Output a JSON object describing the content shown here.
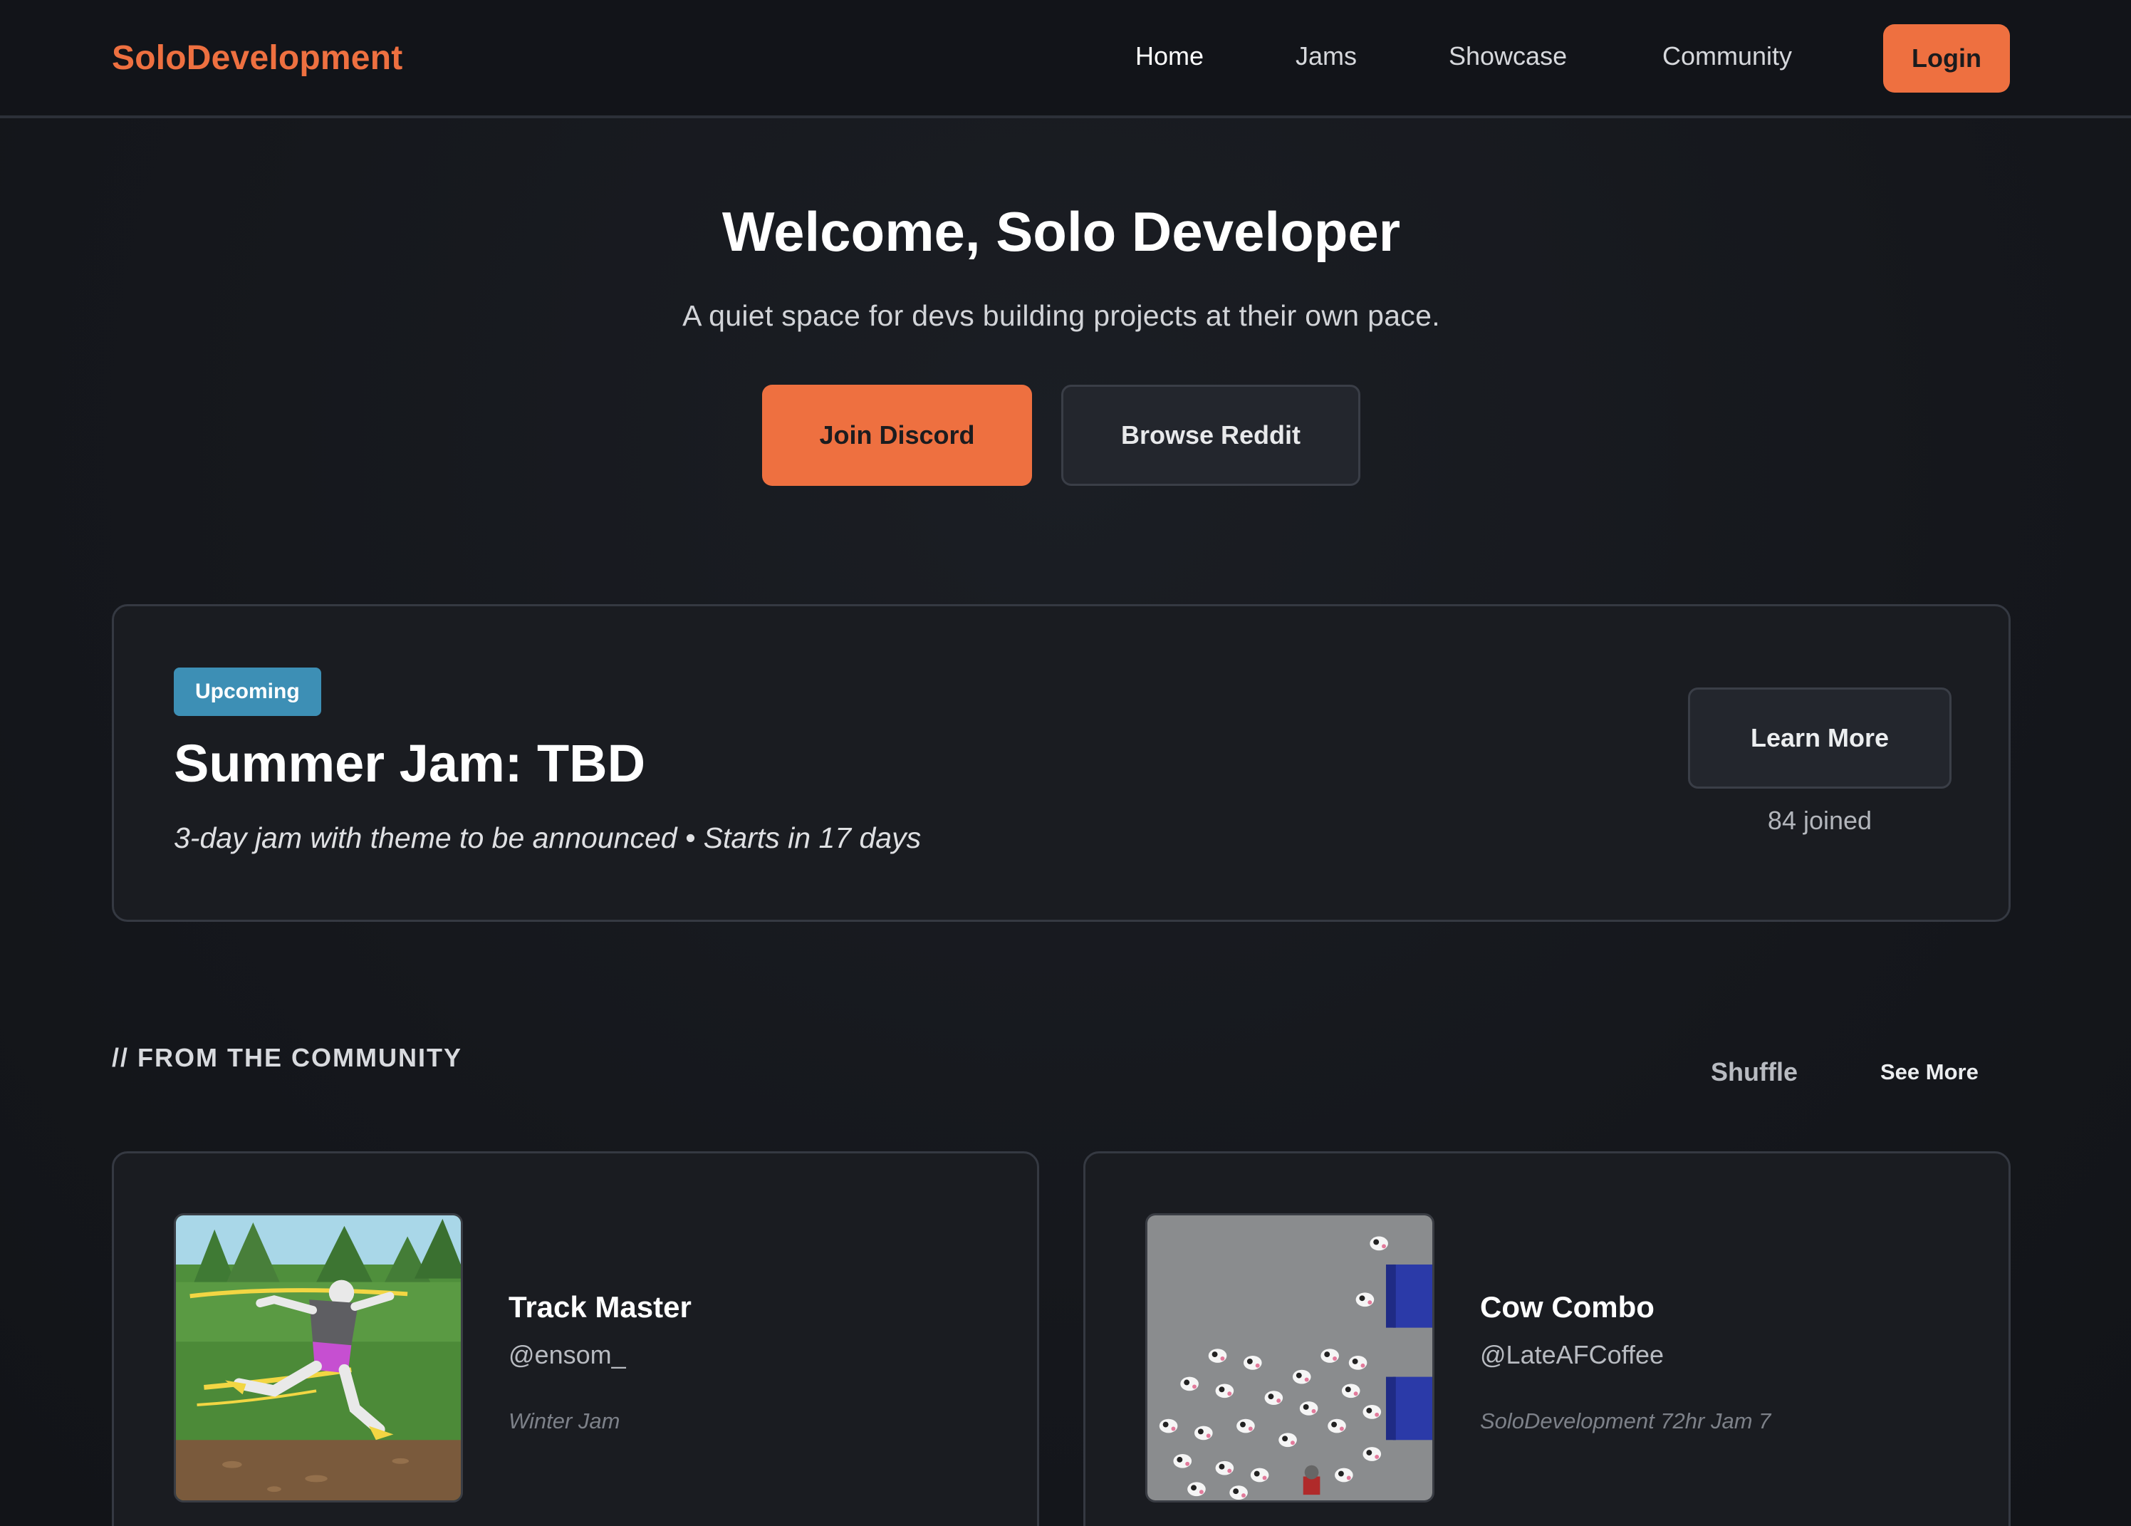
{
  "nav": {
    "brand": "SoloDevelopment",
    "links": [
      "Home",
      "Jams",
      "Showcase",
      "Community"
    ],
    "active": "Home",
    "login_label": "Login"
  },
  "hero": {
    "title": "Welcome, Solo Developer",
    "subtitle": "A quiet space for devs building projects at their own pace.",
    "primary_button": "Join Discord",
    "secondary_button": "Browse Reddit"
  },
  "jam": {
    "badge": "Upcoming",
    "title": "Summer Jam: TBD",
    "description": "3-day jam with theme to be announced • Starts in 17 days",
    "learn_more_label": "Learn More",
    "joined": "84 joined"
  },
  "community": {
    "section_title": "// FROM THE COMMUNITY",
    "shuffle_label": "Shuffle",
    "see_more_label": "See More",
    "games": [
      {
        "title": "Track Master",
        "author": "@ensom_",
        "jam": "Winter Jam",
        "thumbnail_icon": "runner-illustration"
      },
      {
        "title": "Cow Combo",
        "author": "@LateAFCoffee",
        "jam": "SoloDevelopment 72hr Jam 7",
        "thumbnail_icon": "cow-swarm-illustration"
      }
    ]
  },
  "colors": {
    "accent": "#ee7040",
    "badge": "#3d8fb5",
    "background": "#16181d",
    "card": "#1a1c21"
  }
}
